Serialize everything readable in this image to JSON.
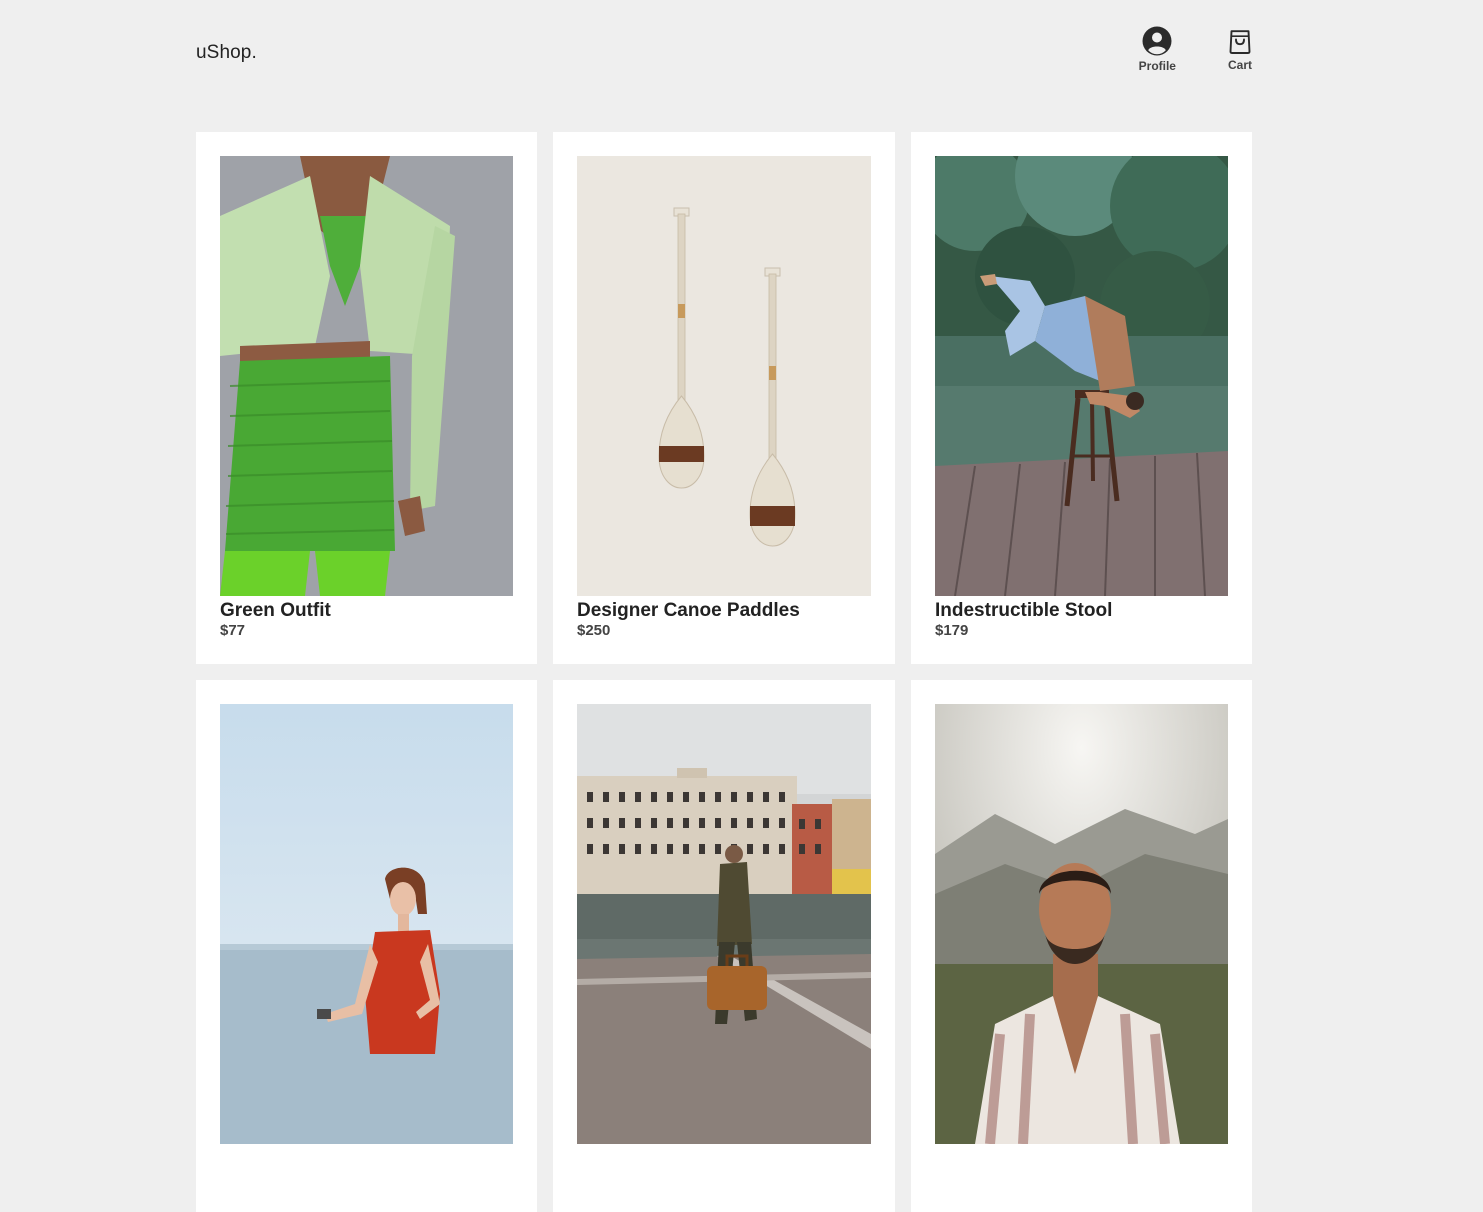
{
  "header": {
    "logo": "uShop.",
    "nav": {
      "profile": {
        "label": "Profile",
        "icon": "user-circle-icon"
      },
      "cart": {
        "label": "Cart",
        "icon": "shopping-bag-icon"
      }
    }
  },
  "products": [
    {
      "name": "Green Outfit",
      "price": "$77",
      "image": "green-outfit-photo"
    },
    {
      "name": "Designer Canoe Paddles",
      "price": "$250",
      "image": "canoe-paddles-photo"
    },
    {
      "name": "Indestructible Stool",
      "price": "$179",
      "image": "stool-photo"
    },
    {
      "name": "",
      "price": "",
      "image": "woman-red-dress-sea-photo"
    },
    {
      "name": "",
      "price": "",
      "image": "man-suitcase-venice-photo"
    },
    {
      "name": "",
      "price": "",
      "image": "man-striped-shirt-portrait-photo"
    }
  ],
  "colors": {
    "page_background": "#efefef",
    "card_background": "#ffffff",
    "text_primary": "#222222",
    "text_secondary": "#444444"
  }
}
